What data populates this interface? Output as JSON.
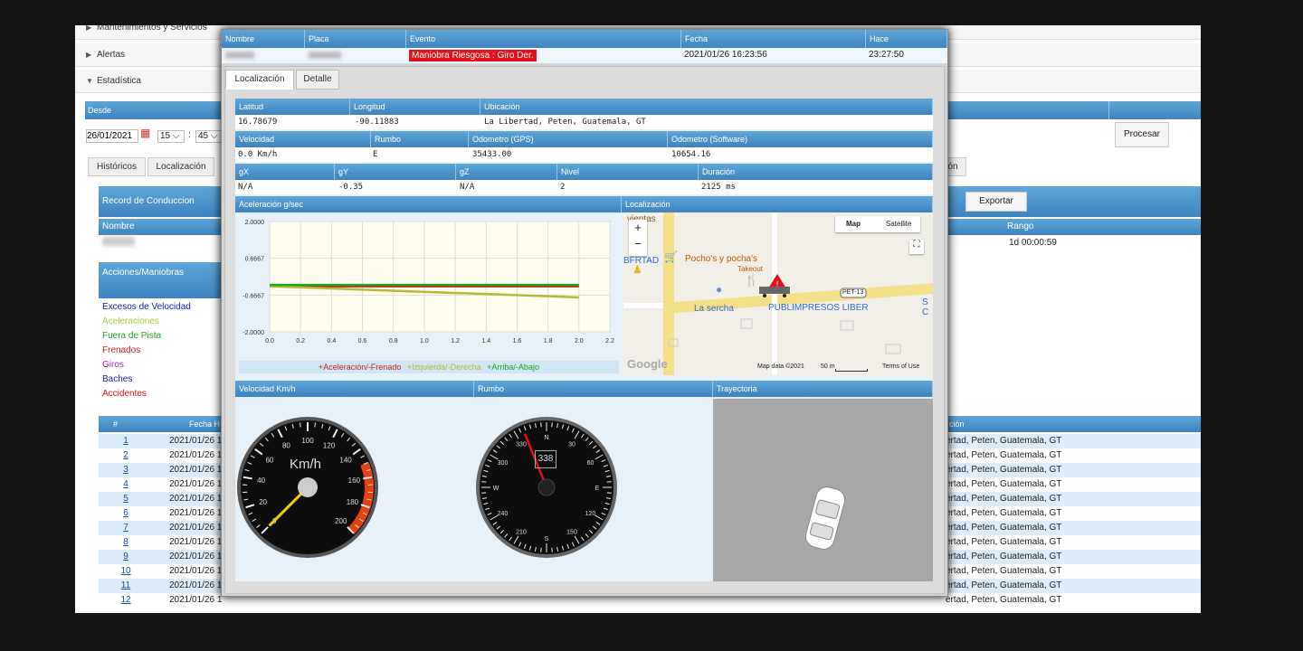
{
  "sidebar_menu": {
    "item1": "Mantenimientos y Servicios",
    "item2": "Alertas",
    "item3": "Estadística"
  },
  "filters": {
    "desde_label": "Desde",
    "date_value": "26/01/2021",
    "hour_value": "15",
    "minute_value": "45",
    "procesar_label": "Procesar"
  },
  "tabs": [
    "Históricos",
    "Localización"
  ],
  "tab_right_partial": "ón",
  "record": {
    "title": "Record de Conduccion",
    "exportar": "Exportar",
    "col_nombre": "Nombre",
    "col_rango": "Rango",
    "rango_value": "1d 00:00:59"
  },
  "acciones": {
    "title": "Acciones/Maniobras",
    "items": [
      {
        "label": "Excesos de Velocidad",
        "color": "#1a1aa8"
      },
      {
        "label": "Aceleraciones",
        "color": "#a8c83a"
      },
      {
        "label": "Fuera de Pista",
        "color": "#1fa51f"
      },
      {
        "label": "Frenados",
        "color": "#c81f1f"
      },
      {
        "label": "Giros",
        "color": "#b21fb2"
      },
      {
        "label": "Baches",
        "color": "#1a1aa8"
      },
      {
        "label": "Accidentes",
        "color": "#e0101a"
      }
    ]
  },
  "table": {
    "col_num": "#",
    "col_fecha": "Fecha H",
    "col_loc": "ción",
    "rows": [
      {
        "n": "1",
        "fecha": "2021/01/26 1",
        "loc": "ertad, Peten, Guatemala, GT"
      },
      {
        "n": "2",
        "fecha": "2021/01/26 1",
        "loc": "ertad, Peten, Guatemala, GT"
      },
      {
        "n": "3",
        "fecha": "2021/01/26 1",
        "loc": "ertad, Peten, Guatemala, GT"
      },
      {
        "n": "4",
        "fecha": "2021/01/26 1",
        "loc": "ertad, Peten, Guatemala, GT"
      },
      {
        "n": "5",
        "fecha": "2021/01/26 1",
        "loc": "ertad, Peten, Guatemala, GT"
      },
      {
        "n": "6",
        "fecha": "2021/01/26 1",
        "loc": "ertad, Peten, Guatemala, GT"
      },
      {
        "n": "7",
        "fecha": "2021/01/26 1",
        "loc": "ertad, Peten, Guatemala, GT"
      },
      {
        "n": "8",
        "fecha": "2021/01/26 1",
        "loc": "ertad, Peten, Guatemala, GT"
      },
      {
        "n": "9",
        "fecha": "2021/01/26 1",
        "loc": "ertad, Peten, Guatemala, GT"
      },
      {
        "n": "10",
        "fecha": "2021/01/26 1",
        "loc": "ertad, Peten, Guatemala, GT"
      },
      {
        "n": "11",
        "fecha": "2021/01/26 1",
        "loc": "ertad, Peten, Guatemala, GT"
      },
      {
        "n": "12",
        "fecha": "2021/01/26 1",
        "loc": "ertad, Peten, Guatemala, GT"
      }
    ]
  },
  "modal": {
    "headers": {
      "nombre": "Nombre",
      "placa": "Placa",
      "evento": "Evento",
      "fecha": "Fecha",
      "hace": "Hace"
    },
    "evento": "Maniobra Riesgosa : Giro Der.",
    "fecha": "2021/01/26 16:23:56",
    "hace": "23:27:50",
    "tabs": [
      "Localización",
      "Detalle"
    ],
    "latitud_h": "Latitud",
    "longitud_h": "Longitud",
    "ubicacion_h": "Ubicación",
    "latitud": "16.78679",
    "longitud": "-90.11883",
    "ubicacion": "La Libertad, Peten, Guatemala, GT",
    "velocidad_h": "Velocidad",
    "rumbo_h": "Rumbo",
    "odo_gps_h": "Odometro (GPS)",
    "odo_sw_h": "Odometro (Software)",
    "velocidad": "0.0 Km/h",
    "rumbo": "E",
    "odo_gps": "35433.00",
    "odo_sw": "10654.16",
    "gx_h": "gX",
    "gy_h": "gY",
    "gz_h": "gZ",
    "nivel_h": "Nivel",
    "duracion_h": "Duración",
    "gx": "N/A",
    "gy": "-0.35",
    "gz": "N/A",
    "nivel": "2",
    "duracion": "2125 ms",
    "acel_h": "Aceleración g/sec",
    "loc_h": "Localización",
    "vel_h": "Velocidad Km/h",
    "rumbo_sec_h": "Rumbo",
    "tray_h": "Trayectoria",
    "chart_legend": {
      "a": "+Aceleración/-Frenado",
      "b": "+Izquierda/-Derecha",
      "c": "+Arriba/-Abajo"
    },
    "speedo_unit": "Km/h",
    "compass_value": "338"
  },
  "map": {
    "map_btn": "Map",
    "sat_btn": "Satellite",
    "label1": "Pocho's y pocha's",
    "label1b": "Takeout",
    "label2": "La serchа",
    "label3": "PUBLIMPRESOS LIBER",
    "label4": "BFRTAD",
    "label5": "vientas",
    "road": "PET-13",
    "attrib": "Map data ©2021",
    "scale": "50 m",
    "terms": "Terms of Use",
    "google": "Google",
    "letter_s": "S",
    "letter_c": "C"
  },
  "chart_data": {
    "type": "line",
    "title": "",
    "xlabel": "",
    "ylabel": "",
    "xlim": [
      0,
      2.2
    ],
    "ylim": [
      -2,
      2
    ],
    "x_ticks": [
      "0.0",
      "0.2",
      "0.4",
      "0.6",
      "0.8",
      "1.0",
      "1.2",
      "1.4",
      "1.6",
      "1.8",
      "2.0",
      "2.2"
    ],
    "y_ticks": [
      "2.0000",
      "0.6667",
      "-0.6667",
      "-2.0000"
    ],
    "series": [
      {
        "name": "+Aceleración/-Frenado",
        "color": "#c81f1f",
        "x": [
          0,
          2.0
        ],
        "y": [
          -0.35,
          -0.35
        ]
      },
      {
        "name": "+Izquierda/-Derecha",
        "color": "#b8b83a",
        "x": [
          0,
          2.0
        ],
        "y": [
          -0.35,
          -0.75
        ]
      },
      {
        "name": "+Arriba/-Abajo",
        "color": "#1fa51f",
        "x": [
          0,
          2.0
        ],
        "y": [
          -0.3,
          -0.3
        ]
      }
    ]
  },
  "speedo_ticks": [
    "0",
    "20",
    "40",
    "60",
    "80",
    "100",
    "120",
    "140",
    "160",
    "180",
    "200"
  ],
  "compass_ticks": [
    "N",
    "E",
    "S",
    "W",
    "30",
    "60",
    "120",
    "150",
    "210",
    "240",
    "300",
    "330"
  ],
  "gauges": {
    "speed": 0,
    "heading": 338
  }
}
